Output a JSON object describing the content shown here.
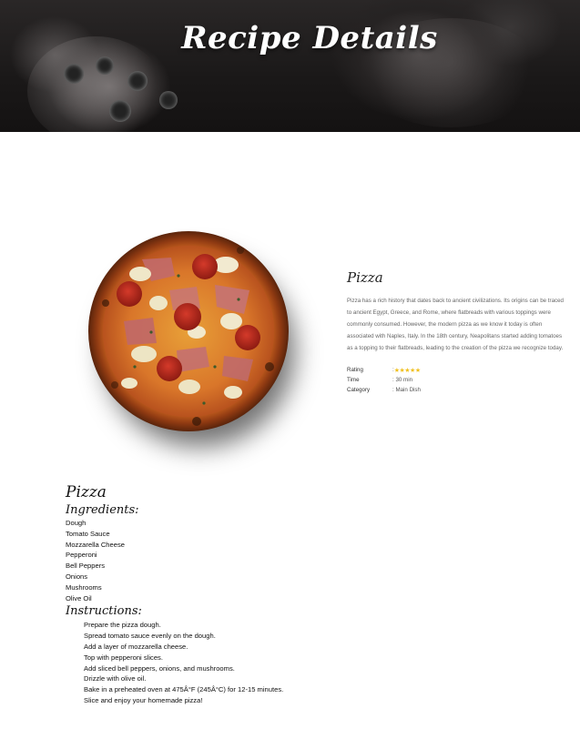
{
  "hero": {
    "title": "Recipe Details"
  },
  "recipe": {
    "name": "Pizza",
    "description": "Pizza has a rich history that dates back to ancient civilizations. Its origins can be traced to ancient Egypt, Greece, and Rome, where flatbreads with various toppings were commonly consumed. However, the modern pizza as we know it today is often associated with Naples, Italy. In the 18th century, Neapolitans started adding tomatoes as a topping to their flatbreads, leading to the creation of the pizza we recognize today.",
    "meta": {
      "rating_label": "Rating",
      "rating_prefix": ":",
      "rating_stars": "★★★★★",
      "rating_value": 5,
      "time_label": "Time",
      "time_value": ": 30 min",
      "category_label": "Category",
      "category_value": ": Main Dish"
    },
    "section_title": "Pizza",
    "ingredients_heading": "Ingredients:",
    "ingredients": [
      "Dough",
      "Tomato Sauce",
      "Mozzarella Cheese",
      "Pepperoni",
      "Bell Peppers",
      "Onions",
      "Mushrooms",
      "Olive Oil"
    ],
    "instructions_heading": "Instructions:",
    "instructions": [
      "Prepare the pizza dough.",
      "Spread tomato sauce evenly on the dough.",
      "Add a layer of mozzarella cheese.",
      "Top with pepperoni slices.",
      "Add sliced bell peppers, onions, and mushrooms.",
      "Drizzle with olive oil.",
      "Bake in a preheated oven at 475Â°F (245Â°C) for 12-15 minutes.",
      "Slice and enjoy your homemade pizza!"
    ]
  },
  "colors": {
    "star": "#f0c020",
    "hero_bg": "#1a1818",
    "text_muted": "#666666"
  }
}
